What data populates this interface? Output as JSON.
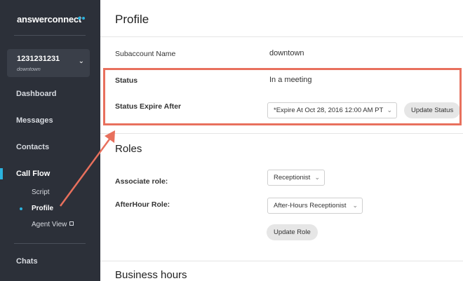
{
  "sidebar": {
    "logo": "answerconnect",
    "account": {
      "id": "1231231231",
      "name": "downtown"
    },
    "items": [
      {
        "label": "Dashboard"
      },
      {
        "label": "Messages"
      },
      {
        "label": "Contacts"
      },
      {
        "label": "Call Flow"
      },
      {
        "label": "Chats"
      }
    ],
    "call_flow_sub": [
      {
        "label": "Script"
      },
      {
        "label": "Profile"
      },
      {
        "label": "Agent View"
      }
    ]
  },
  "profile": {
    "title": "Profile",
    "subaccount_label": "Subaccount Name",
    "subaccount_value": "downtown",
    "status_label": "Status",
    "status_value": "In a meeting",
    "expire_label": "Status Expire After",
    "expire_select": "*Expire At Oct 28, 2016 12:00 AM PT",
    "update_status": "Update Status"
  },
  "roles": {
    "title": "Roles",
    "associate_label": "Associate role:",
    "associate_select": "Receptionist",
    "afterhour_label": "AfterHour Role:",
    "afterhour_select": "After-Hours Receptionist",
    "update_role": "Update Role"
  },
  "business_hours": {
    "title": "Business hours"
  },
  "colors": {
    "sidebar_bg": "#2c3039",
    "accent": "#2bb3df",
    "annotation": "#e8705d"
  }
}
